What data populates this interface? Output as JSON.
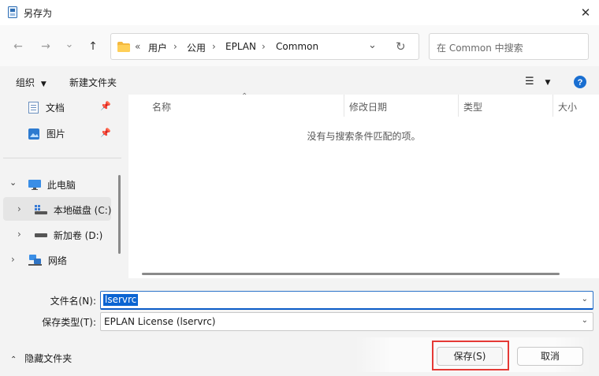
{
  "window": {
    "title": "另存为",
    "close_glyph": "✕"
  },
  "nav": {
    "back_glyph": "←",
    "forward_glyph": "→",
    "recent_glyph": "⌄",
    "up_glyph": "↑",
    "overflow": "«",
    "breadcrumb": [
      "用户",
      "公用",
      "EPLAN",
      "Common"
    ],
    "refresh_glyph": "↻"
  },
  "search": {
    "placeholder": "在 Common 中搜索"
  },
  "toolbar": {
    "organize_label": "组织",
    "new_folder_label": "新建文件夹"
  },
  "sidebar": {
    "items": [
      {
        "label": "文档",
        "icon": "document-icon",
        "pinned": true
      },
      {
        "label": "图片",
        "icon": "picture-icon",
        "pinned": true
      },
      {
        "label": "此电脑",
        "icon": "computer-icon"
      },
      {
        "label": "本地磁盘 (C:)",
        "icon": "local-disk-icon",
        "selected": true
      },
      {
        "label": "新加卷 (D:)",
        "icon": "drive-icon"
      },
      {
        "label": "网络",
        "icon": "network-icon"
      }
    ]
  },
  "columns": [
    "名称",
    "修改日期",
    "类型",
    "大小"
  ],
  "empty_message": "没有与搜索条件匹配的项。",
  "form": {
    "filename_label": "文件名(N):",
    "filename_value": "lservrc",
    "filetype_label": "保存类型(T):",
    "filetype_value": "EPLAN License (lservrc)"
  },
  "footer": {
    "hide_folders_label": "隐藏文件夹",
    "save_label": "保存(S)",
    "cancel_label": "取消"
  },
  "colors": {
    "accent": "#0a64d2",
    "highlight_box": "#e53935",
    "help_blue": "#1a6fd1"
  }
}
